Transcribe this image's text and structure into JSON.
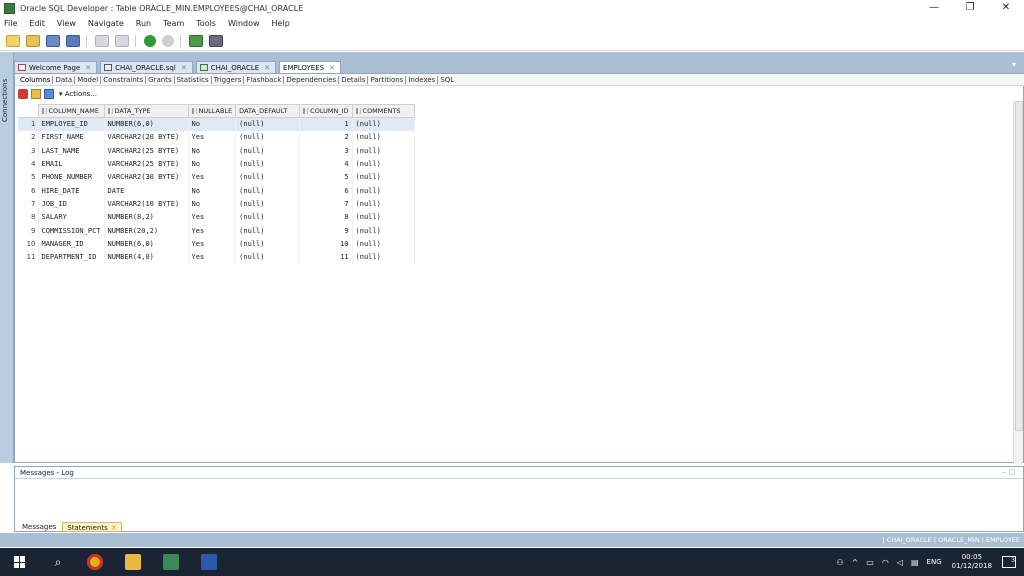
{
  "window": {
    "title": "Oracle SQL Developer : Table ORACLE_MIN.EMPLOYEES@CHAI_ORACLE",
    "minimize": "—",
    "maximize": "❐",
    "close": "✕"
  },
  "menu": [
    "File",
    "Edit",
    "View",
    "Navigate",
    "Run",
    "Team",
    "Tools",
    "Window",
    "Help"
  ],
  "leftbar": {
    "label": "Connections"
  },
  "doc_tabs": [
    {
      "label": "Welcome Page",
      "icon": "welcome-icon"
    },
    {
      "label": "CHAI_ORACLE.sql",
      "icon": "sql-file-icon"
    },
    {
      "label": "CHAI_ORACLE",
      "icon": "connection-icon"
    },
    {
      "label": "EMPLOYEES",
      "icon": "table-icon"
    }
  ],
  "sub_tabs": [
    "Columns",
    "Data",
    "Model",
    "Constraints",
    "Grants",
    "Statistics",
    "Triggers",
    "Flashback",
    "Dependencies",
    "Details",
    "Partitions",
    "Indexes",
    "SQL"
  ],
  "actions_label": "▾ Actions...",
  "grid": {
    "columns": [
      "COLUMN_NAME",
      "DATA_TYPE",
      "NULLABLE",
      "DATA_DEFAULT",
      "COLUMN_ID",
      "COMMENTS"
    ],
    "rows": [
      [
        "1",
        "EMPLOYEE_ID",
        "NUMBER(6,0)",
        "No",
        "(null)",
        "1",
        "(null)"
      ],
      [
        "2",
        "FIRST_NAME",
        "VARCHAR2(20 BYTE)",
        "Yes",
        "(null)",
        "2",
        "(null)"
      ],
      [
        "3",
        "LAST_NAME",
        "VARCHAR2(25 BYTE)",
        "No",
        "(null)",
        "3",
        "(null)"
      ],
      [
        "4",
        "EMAIL",
        "VARCHAR2(25 BYTE)",
        "No",
        "(null)",
        "4",
        "(null)"
      ],
      [
        "5",
        "PHONE_NUMBER",
        "VARCHAR2(30 BYTE)",
        "Yes",
        "(null)",
        "5",
        "(null)"
      ],
      [
        "6",
        "HIRE_DATE",
        "DATE",
        "No",
        "(null)",
        "6",
        "(null)"
      ],
      [
        "7",
        "JOB_ID",
        "VARCHAR2(10 BYTE)",
        "No",
        "(null)",
        "7",
        "(null)"
      ],
      [
        "8",
        "SALARY",
        "NUMBER(8,2)",
        "Yes",
        "(null)",
        "8",
        "(null)"
      ],
      [
        "9",
        "COMMISSION_PCT",
        "NUMBER(20,2)",
        "Yes",
        "(null)",
        "9",
        "(null)"
      ],
      [
        "10",
        "MANAGER_ID",
        "NUMBER(6,0)",
        "Yes",
        "(null)",
        "10",
        "(null)"
      ],
      [
        "11",
        "DEPARTMENT_ID",
        "NUMBER(4,0)",
        "Yes",
        "(null)",
        "11",
        "(null)"
      ]
    ]
  },
  "messages": {
    "title": "Messages - Log",
    "tabs": [
      "Messages",
      "Statements"
    ]
  },
  "status": {
    "text": "| CHAI_ORACLE | ORACLE_MIN | EMPLOYEE"
  },
  "taskbar": {
    "lang": "ENG",
    "time": "00:05",
    "date": "01/12/2018",
    "notifications": "3"
  }
}
